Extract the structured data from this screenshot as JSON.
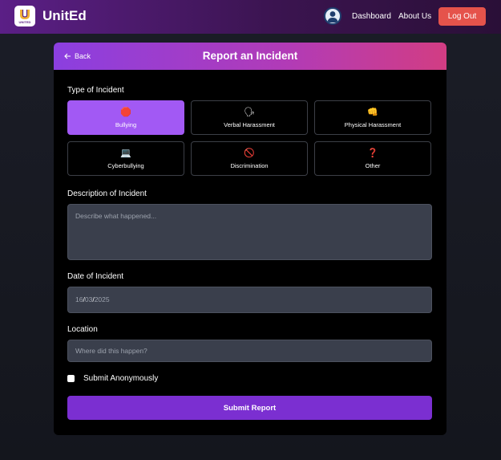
{
  "nav": {
    "brand": "UnitEd",
    "logo_small_text": "UNITED",
    "links": [
      "Dashboard",
      "About Us"
    ],
    "logout_label": "Log Out"
  },
  "form": {
    "back_label": "Back",
    "title": "Report an Incident",
    "type_label": "Type of Incident",
    "incident_types": [
      {
        "label": "Bullying",
        "icon": "🛑",
        "selected": true
      },
      {
        "label": "Verbal Harassment",
        "icon": "🗣",
        "selected": false
      },
      {
        "label": "Physical Harassment",
        "icon": "👊",
        "selected": false
      },
      {
        "label": "Cyberbullying",
        "icon": "💻",
        "selected": false
      },
      {
        "label": "Discrimination",
        "icon": "🚫",
        "selected": false
      },
      {
        "label": "Other",
        "icon": "❓",
        "selected": false
      }
    ],
    "description_label": "Description of Incident",
    "description_placeholder": "Describe what happened...",
    "date_label": "Date of Incident",
    "date_day": "16",
    "date_month": "03",
    "date_year": "2025",
    "location_label": "Location",
    "location_placeholder": "Where did this happen?",
    "anonymous_label": "Submit Anonymously",
    "anonymous_checked": false,
    "submit_label": "Submit Report"
  },
  "colors": {
    "accent": "#7b2fd1",
    "selected": "#a259f4",
    "logout": "#e5534b"
  }
}
